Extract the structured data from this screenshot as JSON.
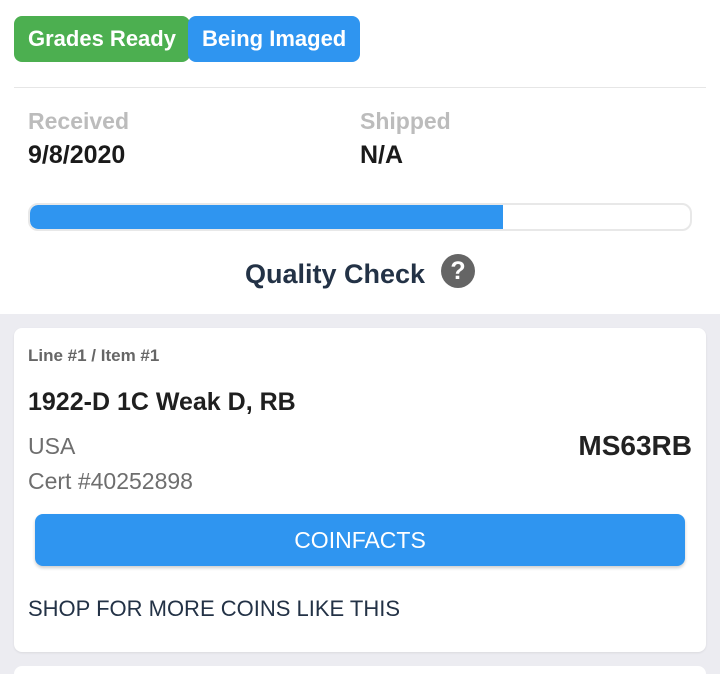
{
  "badges": {
    "grades_ready": "Grades Ready",
    "being_imaged": "Being Imaged"
  },
  "dates": {
    "received_label": "Received",
    "received_value": "9/8/2020",
    "shipped_label": "Shipped",
    "shipped_value": "N/A"
  },
  "progress": {
    "fraction": 0.716,
    "status": "Quality Check",
    "help_icon": "question-circle-icon",
    "help_glyph": "?"
  },
  "item": {
    "line_label": "Line #1 / Item #1",
    "name": "1922-D 1C Weak D, RB",
    "country": "USA",
    "cert": "Cert #40252898",
    "grade": "MS63RB",
    "coinfacts_label": "COINFACTS",
    "shop_label": "SHOP FOR MORE COINS LIKE THIS"
  },
  "colors": {
    "green": "#4caf50",
    "blue": "#2f95f0",
    "navy": "#233246",
    "background_gray": "#ececf1"
  }
}
